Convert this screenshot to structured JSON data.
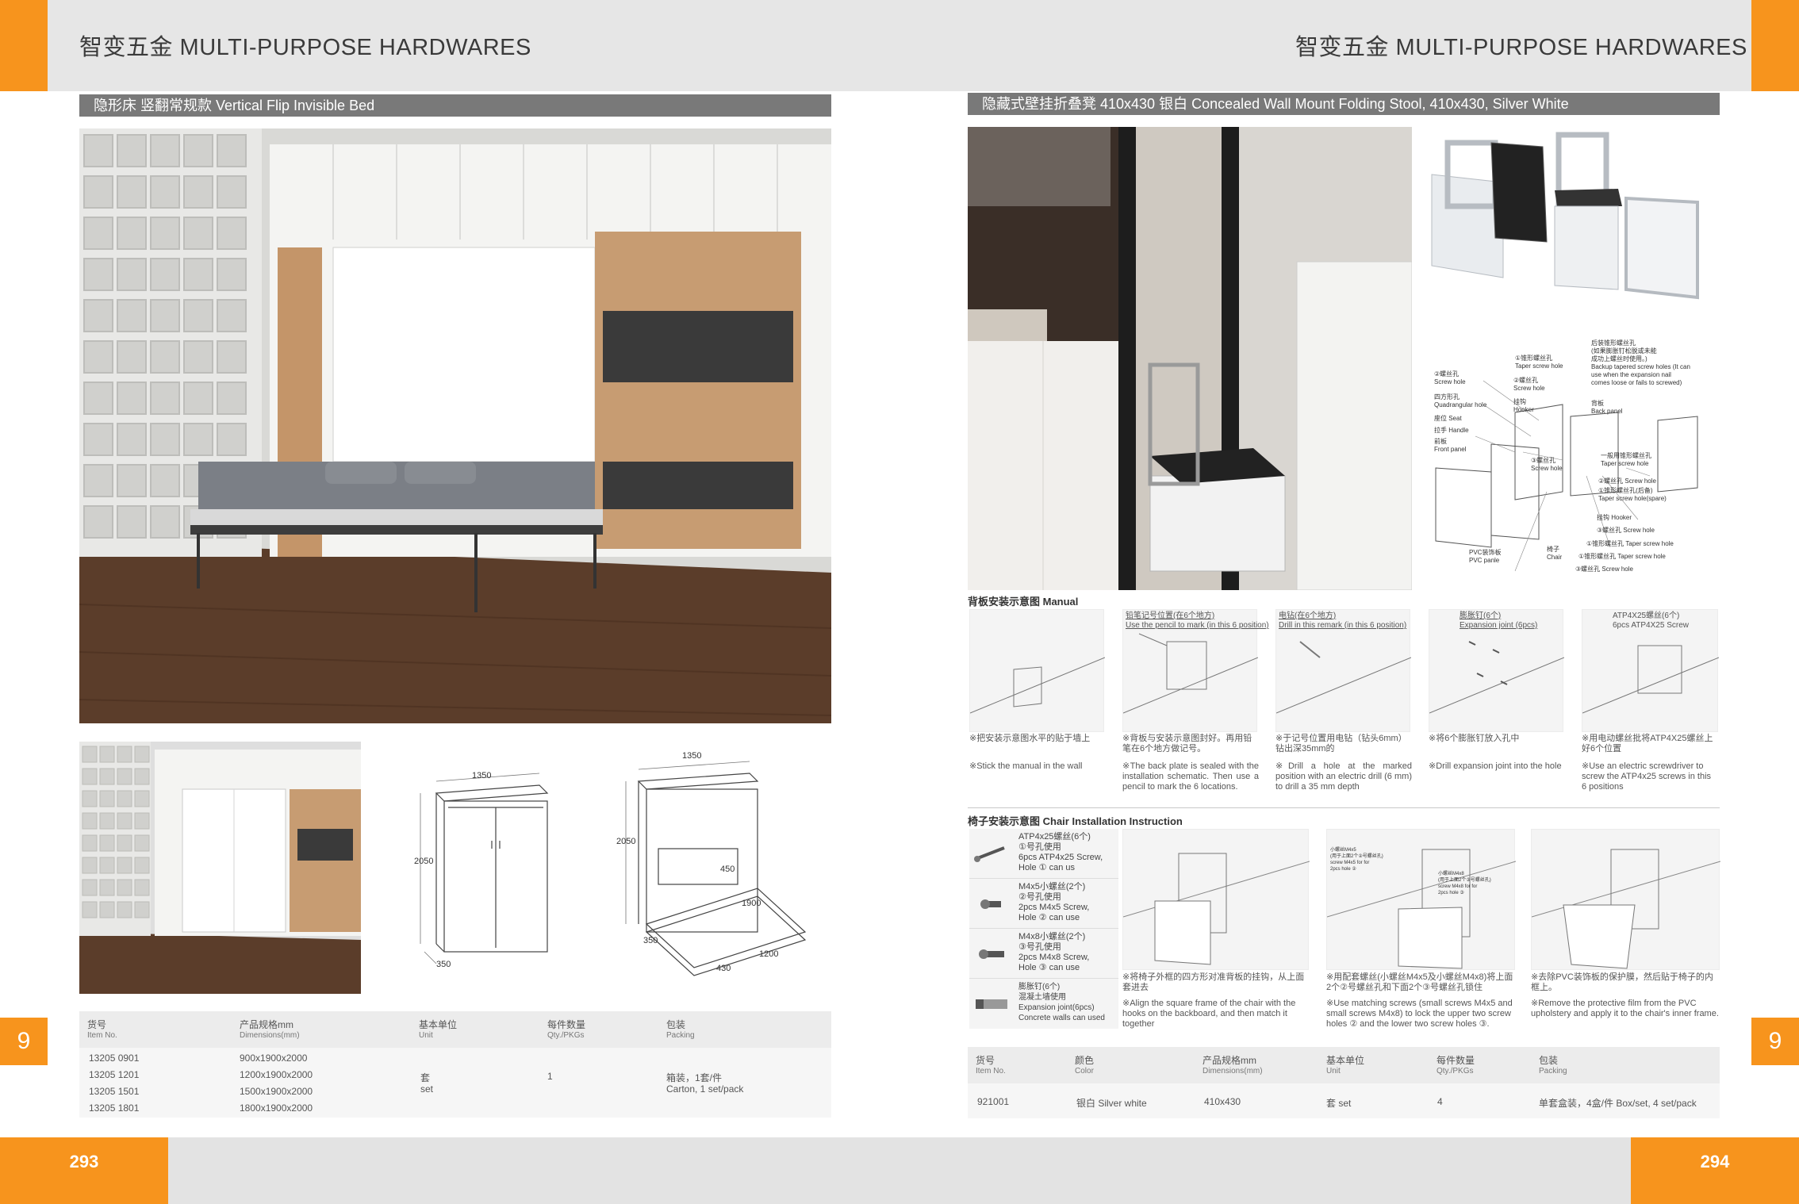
{
  "header": {
    "title_left": "智变五金  MULTI-PURPOSE HARDWARES",
    "title_right": "智变五金  MULTI-PURPOSE HARDWARES"
  },
  "left": {
    "section_title": "隐形床  竖翻常规款    Vertical Flip Invisible Bed",
    "dims_closed": {
      "width": "1350",
      "height": "2050",
      "depth": "350"
    },
    "dims_open": {
      "width": "1350",
      "height": "2050",
      "depth": "350",
      "bed_height": "450",
      "bed_length": "1900",
      "bed_width": "1200",
      "opening": "430"
    },
    "table": {
      "headers": [
        {
          "cn": "货号",
          "en": "Item No."
        },
        {
          "cn": "产品规格mm",
          "en": "Dimensions(mm)"
        },
        {
          "cn": "基本单位",
          "en": "Unit"
        },
        {
          "cn": "每件数量",
          "en": "Qty./PKGs"
        },
        {
          "cn": "包装",
          "en": "Packing"
        }
      ],
      "rows": [
        {
          "item": "13205 0901",
          "dim": "900x1900x2000"
        },
        {
          "item": "13205 1201",
          "dim": "1200x1900x2000"
        },
        {
          "item": "13205 1501",
          "dim": "1500x1900x2000"
        },
        {
          "item": "13205 1801",
          "dim": "1800x1900x2000"
        }
      ],
      "unit_cn": "套",
      "unit_en": "set",
      "qty": "1",
      "packing_cn": "箱装，1套/件",
      "packing_en": "Carton, 1 set/pack"
    },
    "page_number": "293",
    "side_number": "9"
  },
  "right": {
    "section_title": "隐藏式壁挂折叠凳 410x430  银白    Concealed Wall Mount Folding Stool, 410x430, Silver White",
    "parts": {
      "taper_top": "①锥形螺丝孔\nTaper screw hole",
      "rear_taper": "后装锥形螺丝孔\n(如果膨胀钉松脱或未能\n成功上螺丝时使用。)\nBackup tapered screw holes (It can\nuse when the expansion nail\ncomes loose or fails to screwed)",
      "screw_hole_2": "②螺丝孔\nScrew hole",
      "screw_hole_2b": "②螺丝孔\nScrew hole",
      "quad_hole": "四方形孔\nQuadrangular hole",
      "hooker": "挂钩\nHooker",
      "back_panel": "背板\nBack panel",
      "seat": "座位  Seat",
      "handle": "拉手  Handle",
      "front_panel": "前板\nFront panel",
      "screw_hole_3": "③螺丝孔\nScrew hole",
      "normal_taper": "一般用锥形螺丝孔\nTaper screw hole",
      "screw_hole_2c": "②螺丝孔  Screw hole",
      "taper_spare": "①锥形螺丝孔(后备)\nTaper screw hole(spare)",
      "hooker2": "挂钩  Hooker",
      "screw_hole_3b": "③螺丝孔  Screw hole",
      "pvc": "PVC装饰板\nPVC panle",
      "chair": "椅子\nChair",
      "taper_1": "①锥形螺丝孔  Taper screw hole",
      "taper_1b": "①锥形螺丝孔  Taper screw hole",
      "screw_hole_3c": "③螺丝孔  Screw hole"
    },
    "manual_title": "背板安装示意图  Manual",
    "manual_steps": [
      {
        "top": "",
        "cn": "※把安装示意图水平的贴于墙上",
        "en": "※Stick the manual in the wall"
      },
      {
        "top": "铅笔记号位置(在6个地方)\nUse the pencil to mark (in this 6 position)",
        "cn": "※背板与安装示意图封好。再用铅笔在6个地方做记号。",
        "en": "※The back plate is sealed with the installation schematic. Then use a pencil to mark the 6 locations."
      },
      {
        "top": "电钻(在6个地方)\nDrill in this remark (in this 6 position)",
        "cn": "※于记号位置用电钻（钻头6mm）钻出深35mm的",
        "en": "※Drill a hole at the marked position with an electric drill (6 mm) to drill a 35 mm depth"
      },
      {
        "top": "膨胀钉(6个)\nExpansion joint (6pcs)",
        "cn": "※将6个膨胀钉放入孔中",
        "en": "※Drill expansion joint into the hole"
      },
      {
        "top": "ATP4X25螺丝(6个)\n6pcs ATP4X25 Screw",
        "cn": "※用电动螺丝批将ATP4X25螺丝上好6个位置",
        "en": "※Use an electric screwdriver to screw the ATP4x25 screws in this 6 positions"
      }
    ],
    "chair_title": "椅子安装示意图  Chair Installation Instruction",
    "screws": [
      {
        "text": "ATP4x25螺丝(6个)\n①号孔使用\n6pcs ATP4x25 Screw,\nHole ① can us"
      },
      {
        "text": "M4x5小螺丝(2个)\n②号孔使用\n2pcs M4x5 Screw,\nHole ② can use"
      },
      {
        "text": "M4x8小螺丝(2个)\n③号孔使用\n2pcs M4x8 Screw,\nHole ③ can use"
      },
      {
        "text": "膨胀钉(6个)\n混凝土墙使用\nExpansion joint(6pcs)\nConcrete walls can used"
      }
    ],
    "chair_steps": [
      {
        "cn": "※将椅子外框的四方形对准背板的挂钩，从上面套进去",
        "en": "※Align the square frame of the chair with the hooks on the backboard, and then match it together"
      },
      {
        "cn": "※用配套螺丝(小螺丝M4x5及小螺丝M4x8)将上面2个②号螺丝孔和下面2个③号螺丝孔锁住",
        "en": "※Use matching screws (small screws M4x5 and small screws M4x8) to lock the upper two screw holes ② and the lower two screw holes ③."
      },
      {
        "cn": "※去除PVC装饰板的保护膜，然后贴于椅子的内框上。",
        "en": "※Remove the protective film from the PVC upholstery and apply it to the chair's inner frame."
      }
    ],
    "chair_step_notes": [
      "小螺丝M4x5\n(用于上面2个②号螺丝孔)\nscrew M4x5 for for\n2pcs hole ②",
      "小螺丝M4x8\n(用于上面2个③号螺丝孔)\nscrew M4x8 for for\n2pcs hole ③"
    ],
    "table": {
      "headers": [
        {
          "cn": "货号",
          "en": "Item No."
        },
        {
          "cn": "颜色",
          "en": "Color"
        },
        {
          "cn": "产品规格mm",
          "en": "Dimensions(mm)"
        },
        {
          "cn": "基本单位",
          "en": "Unit"
        },
        {
          "cn": "每件数量",
          "en": "Qty./PKGs"
        },
        {
          "cn": "包装",
          "en": "Packing"
        }
      ],
      "row": {
        "item": "921001",
        "color": "银白  Silver white",
        "dim": "410x430",
        "unit": "套  set",
        "qty": "4",
        "packing": "单套盒装，4盒/件    Box/set, 4 set/pack"
      }
    },
    "page_number": "294",
    "side_number": "9"
  },
  "colors": {
    "accent": "#f7941d",
    "bar": "#797979",
    "band": "#e6e6e6"
  }
}
